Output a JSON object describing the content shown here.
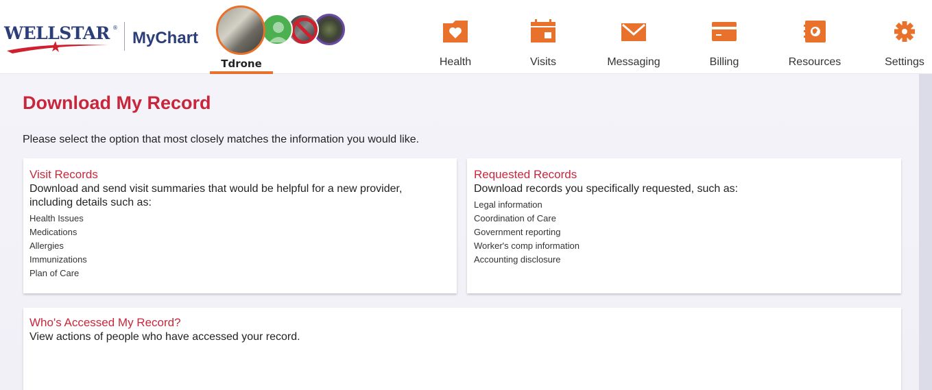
{
  "brand": {
    "wellstar": "WELLSTAR",
    "registered": "®",
    "mychart": "MyChart"
  },
  "proxy": {
    "active_name": "Tdrone",
    "avatars": [
      "avatar-active",
      "avatar-green",
      "avatar-blocked",
      "avatar-purple"
    ]
  },
  "nav": {
    "items": [
      {
        "label": "Health",
        "icon": "health-icon"
      },
      {
        "label": "Visits",
        "icon": "calendar-icon"
      },
      {
        "label": "Messaging",
        "icon": "envelope-icon"
      },
      {
        "label": "Billing",
        "icon": "credit-card-icon"
      },
      {
        "label": "Resources",
        "icon": "book-icon"
      },
      {
        "label": "Settings",
        "icon": "gear-icon"
      }
    ],
    "icon_color": "#e8712b"
  },
  "page": {
    "title": "Download My Record",
    "intro": "Please select the option that most closely matches the information you would like."
  },
  "cards": {
    "visit": {
      "title": "Visit Records",
      "desc": "Download and send visit summaries that would be helpful for a new provider, including details such as:",
      "items": [
        "Health Issues",
        "Medications",
        "Allergies",
        "Immunizations",
        "Plan of Care"
      ]
    },
    "requested": {
      "title": "Requested Records",
      "desc": "Download records you specifically requested, such as:",
      "items": [
        "Legal information",
        "Coordination of Care",
        "Government reporting",
        "Worker's comp information",
        "Accounting disclosure"
      ]
    },
    "accessed": {
      "title": "Who's Accessed My Record?",
      "desc": "View actions of people who have accessed your record."
    }
  },
  "colors": {
    "accent": "#c8273b",
    "brand_navy": "#2c3e7a",
    "brand_red": "#d0202e",
    "orange": "#e8712b",
    "page_bg": "#f3f2f8"
  }
}
